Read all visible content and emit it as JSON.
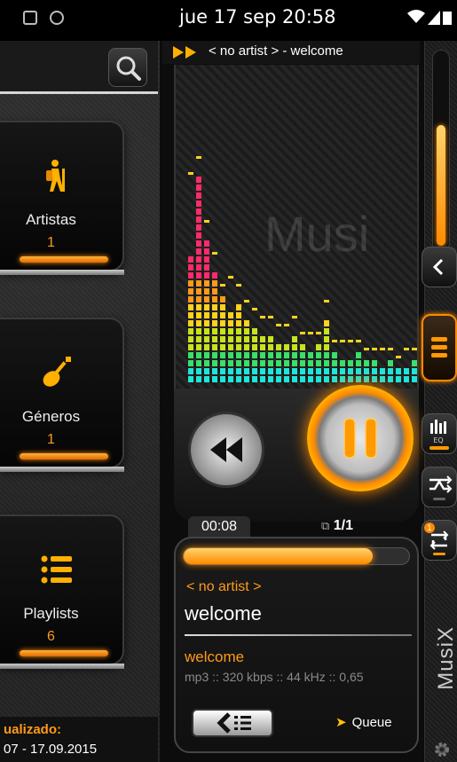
{
  "status_bar": {
    "time": "jue 17 sep 20:58",
    "icons": [
      "media-icon",
      "circle-icon",
      "wifi-icon",
      "signal-icon",
      "battery-icon"
    ]
  },
  "colors": {
    "accent": "#ff8a00",
    "accent_text": "#ff9a1a",
    "bg": "#0c0c0c"
  },
  "library": {
    "categories": [
      {
        "label": "Artistas",
        "count": "1",
        "icon": "hiker-icon"
      },
      {
        "label": "Géneros",
        "count": "1",
        "icon": "guitar-icon"
      },
      {
        "label": "Playlists",
        "count": "6",
        "icon": "list-icon"
      }
    ],
    "updated_label": "ualizado:",
    "updated_range": "07 - 17.09.2015"
  },
  "now_playing": {
    "text": "< no artist > - welcome"
  },
  "visualizer": {
    "logo": "Musi"
  },
  "player": {
    "elapsed": "00:08",
    "queue_position": "1/1",
    "progress": 0.84,
    "artist": "< no artist >",
    "title": "welcome",
    "album": "welcome",
    "info": "mp3 :: 320 kbps :: 44 kHz :: 0,65",
    "queue_label": "Queue"
  },
  "sidebar": {
    "volume": 0.6,
    "eq_label": "EQ",
    "brand": "MusiX",
    "repeat_badge": "1"
  }
}
